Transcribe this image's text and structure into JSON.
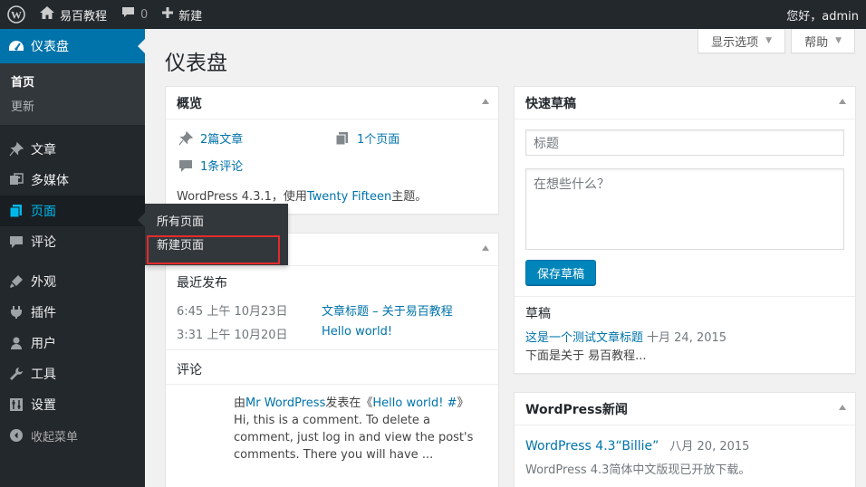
{
  "adminbar": {
    "site_name": "易百教程",
    "comments_count": "0",
    "new_label": "新建",
    "greeting": "您好，admin"
  },
  "sidebar": {
    "dashboard_label": "仪表盘",
    "dashboard_sub": [
      "首页",
      "更新"
    ],
    "items": [
      {
        "label": "文章",
        "icon": "pushpin-icon"
      },
      {
        "label": "多媒体",
        "icon": "media-icon"
      },
      {
        "label": "页面",
        "icon": "pages-icon"
      },
      {
        "label": "评论",
        "icon": "comment-icon"
      },
      {
        "label": "外观",
        "icon": "appearance-icon"
      },
      {
        "label": "插件",
        "icon": "plugin-icon"
      },
      {
        "label": "用户",
        "icon": "user-icon"
      },
      {
        "label": "工具",
        "icon": "wrench-icon"
      },
      {
        "label": "设置",
        "icon": "settings-icon"
      }
    ],
    "collapse_label": "收起菜单"
  },
  "flyout": {
    "items": [
      "所有页面",
      "新建页面"
    ]
  },
  "screen": {
    "options_label": "显示选项",
    "help_label": "帮助"
  },
  "page_title": "仪表盘",
  "overview": {
    "title": "概览",
    "posts": "2篇文章",
    "pages": "1个页面",
    "comments": "1条评论",
    "footer_prefix": "WordPress 4.3.1，使用",
    "theme": "Twenty Fifteen",
    "footer_suffix": "主题。"
  },
  "activity": {
    "recent_title": "最近发布",
    "rows": [
      {
        "when": "6:45 上午 10月23日",
        "what": "文章标题 – 关于易百教程"
      },
      {
        "when": "3:31 上午 10月20日",
        "what": "Hello world!"
      }
    ],
    "comments_title": "评论",
    "comment_from": "由",
    "comment_author": "Mr WordPress",
    "comment_on": "发表在《",
    "comment_post": "Hello world! #",
    "comment_close": "》",
    "comment_body": "Hi, this is a comment. To delete a comment, just log in and view the post's comments. There you will have ..."
  },
  "quick_draft": {
    "title": "快速草稿",
    "title_placeholder": "标题",
    "content_placeholder": "在想些什么？",
    "save_label": "保存草稿",
    "drafts_title": "草稿",
    "draft_title": "这是一个测试文章标题",
    "draft_date": "十月 24, 2015",
    "draft_excerpt": "下面是关于 易百教程..."
  },
  "news": {
    "title": "WordPress新闻",
    "headline": "WordPress 4.3“Billie”",
    "date": "八月 20, 2015",
    "desc": "WordPress 4.3简体中文版现已开放下载。"
  },
  "colors": {
    "adminbar_bg": "#23282d",
    "accent": "#0073aa",
    "highlight_box": "#e32c2c"
  }
}
